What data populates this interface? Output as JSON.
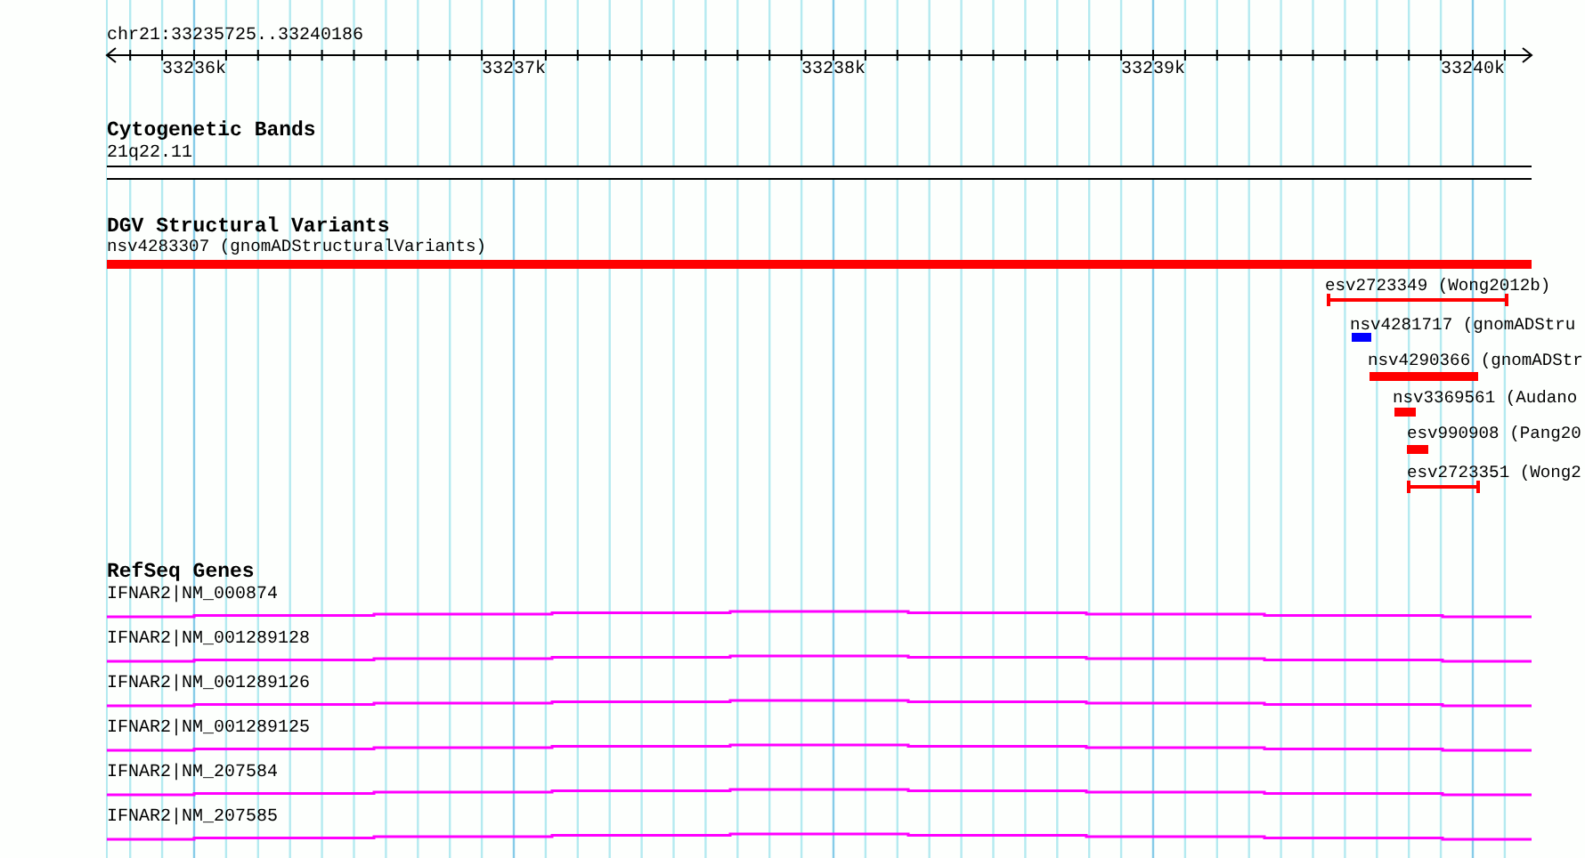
{
  "ruler": {
    "location": "chr21:33235725..33240186",
    "ticks": [
      "33236k",
      "33237k",
      "33238k",
      "33239k",
      "33240k"
    ]
  },
  "tracks": [
    {
      "kind": "cytoband",
      "title": "Cytogenetic Bands",
      "band": "21q22.11"
    },
    {
      "kind": "variants",
      "title": "DGV Structural Variants",
      "features": [
        {
          "label": "nsv4283307 (gnomADStructuralVariants)",
          "kind": "bar",
          "color": "#ff0000"
        },
        {
          "label": "esv2723349 (Wong2012b)",
          "kind": "span",
          "color": "#ff0000"
        },
        {
          "label": "nsv4281717 (gnomADStru",
          "kind": "bar",
          "color": "#0000ff"
        },
        {
          "label": "nsv4290366 (gnomADStr",
          "kind": "bar",
          "color": "#ff0000"
        },
        {
          "label": "nsv3369561 (Audano",
          "kind": "bar",
          "color": "#ff0000"
        },
        {
          "label": "esv990908 (Pang20",
          "kind": "bar",
          "color": "#ff0000"
        },
        {
          "label": "esv2723351 (Wong2",
          "kind": "span",
          "color": "#ff0000"
        }
      ]
    },
    {
      "kind": "genes",
      "title": "RefSeq Genes",
      "transcripts": [
        "IFNAR2|NM_000874",
        "IFNAR2|NM_001289128",
        "IFNAR2|NM_001289126",
        "IFNAR2|NM_001289125",
        "IFNAR2|NM_207584",
        "IFNAR2|NM_207585"
      ]
    }
  ]
}
